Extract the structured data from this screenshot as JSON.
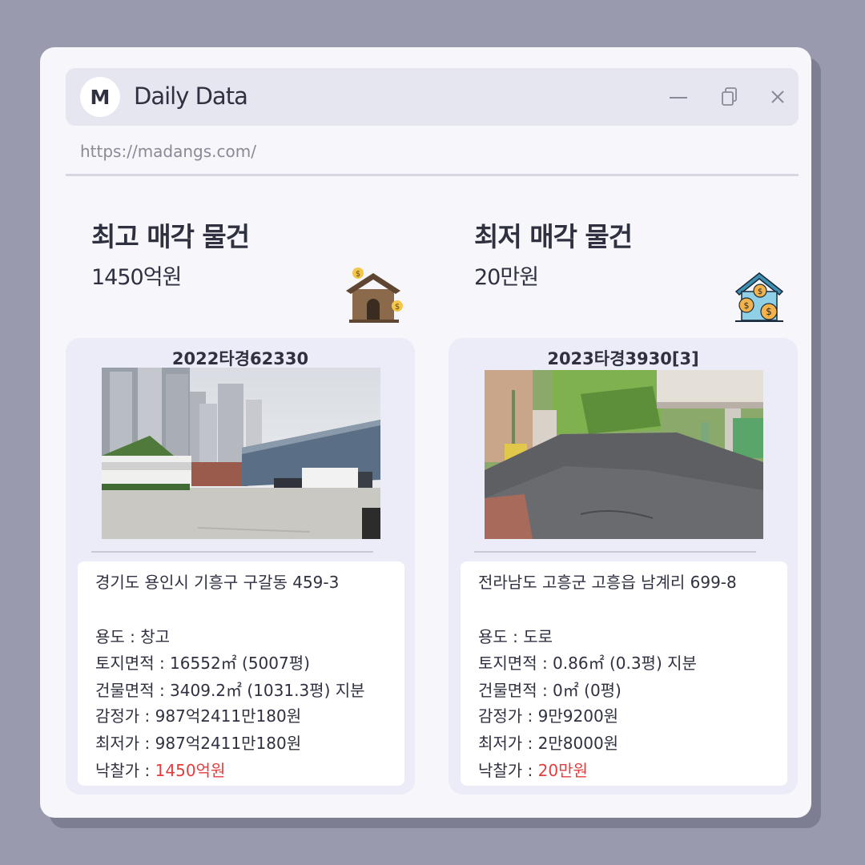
{
  "window": {
    "logo_letter": "M",
    "title": "Daily Data",
    "url": "https://madangs.com/",
    "controls": [
      "minimize-icon",
      "copy-icon",
      "close-icon"
    ]
  },
  "highest": {
    "heading": "최고 매각 물건",
    "amount": "1450억원",
    "icon": "house-money-icon",
    "case_no": "2022타경62330",
    "photo": "warehouse-photo",
    "address": "경기도 용인시 기흥구 구갈동 459-3",
    "usage": "용도 : 창고",
    "land_area": "토지면적 : 16552㎡ (5007평)",
    "building_area": "건물면적 : 3409.2㎡ (1031.3평) 지분",
    "appraisal": "감정가 : 987억2411만180원",
    "minimum": "최저가 : 987억2411만180원",
    "winning_label": "낙찰가 : ",
    "winning_value": "1450억원"
  },
  "lowest": {
    "heading": "최저 매각 물건",
    "amount": "20만원",
    "icon": "house-coins-icon",
    "case_no": "2023타경3930[3]",
    "photo": "road-photo",
    "address": "전라남도 고흥군 고흥읍 남계리 699-8",
    "usage": "용도 : 도로",
    "land_area": "토지면적 : 0.86㎡ (0.3평) 지분",
    "building_area": "건물면적 : 0㎡ (0평)",
    "appraisal": "감정가 : 9만9200원",
    "minimum": "최저가 : 2만8000원",
    "winning_label": "낙찰가 : ",
    "winning_value": "20만원"
  },
  "colors": {
    "background": "#9a9aae",
    "window": "#f6f6fb",
    "card": "#ebecf7",
    "accent_red": "#e33d3d",
    "text": "#2f3140"
  }
}
